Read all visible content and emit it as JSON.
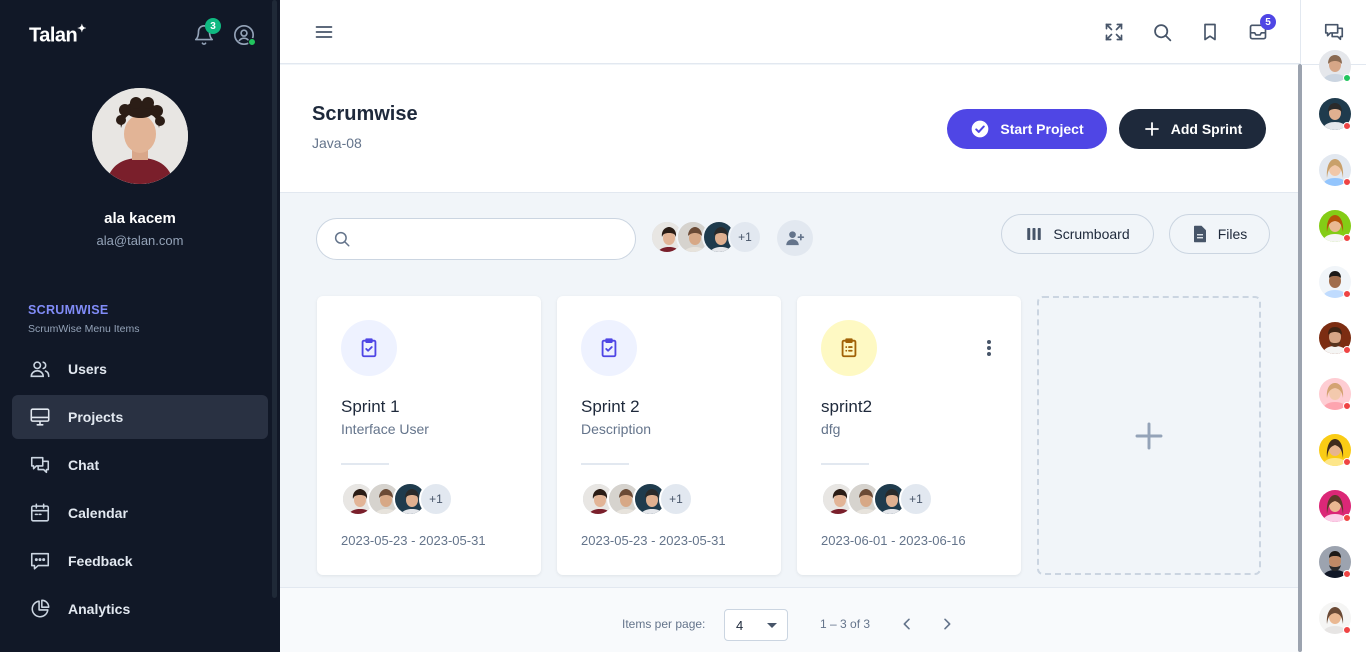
{
  "app": {
    "logo": "Talan",
    "logo_mark": "✦"
  },
  "sidebar": {
    "notification_count": "3",
    "user": {
      "name": "ala kacem",
      "email": "ala@talan.com"
    },
    "section_title": "SCRUMWISE",
    "section_subtitle": "ScrumWise Menu Items",
    "items": [
      {
        "label": "Users",
        "icon": "users-icon",
        "active": false
      },
      {
        "label": "Projects",
        "icon": "monitor-icon",
        "active": true
      },
      {
        "label": "Chat",
        "icon": "chat-icon",
        "active": false
      },
      {
        "label": "Calendar",
        "icon": "calendar-icon",
        "active": false
      },
      {
        "label": "Feedback",
        "icon": "feedback-icon",
        "active": false
      },
      {
        "label": "Analytics",
        "icon": "pie-chart-icon",
        "active": false
      }
    ]
  },
  "topbar": {
    "mail_count": "5"
  },
  "project": {
    "title": "Scrumwise",
    "subtitle": "Java-08"
  },
  "actions": {
    "start_project": "Start Project",
    "add_sprint": "Add Sprint"
  },
  "toolbar": {
    "search_placeholder": "",
    "members_more": "+1",
    "scrumboard": "Scrumboard",
    "files": "Files"
  },
  "sprints": [
    {
      "title": "Sprint 1",
      "description": "Interface User",
      "members_more": "+1",
      "dates": "2023-05-23 - 2023-05-31",
      "icon_color": "#4f46e5",
      "icon_bg": "#eef2ff"
    },
    {
      "title": "Sprint 2",
      "description": "Description",
      "members_more": "+1",
      "dates": "2023-05-23 - 2023-05-31",
      "icon_color": "#4f46e5",
      "icon_bg": "#eef2ff"
    },
    {
      "title": "sprint2",
      "description": "dfg",
      "members_more": "+1",
      "dates": "2023-06-01 - 2023-06-16",
      "icon_color": "#a16207",
      "icon_bg": "#fef9c3"
    }
  ],
  "pagination": {
    "items_per_page_label": "Items per page:",
    "items_per_page": "4",
    "range": "1 – 3 of 3"
  },
  "colors": {
    "accent": "#4f46e5",
    "sidebar_bg": "#111827",
    "dark_button": "#1e293b",
    "online": "#22c55e",
    "offline": "#ef4444"
  }
}
